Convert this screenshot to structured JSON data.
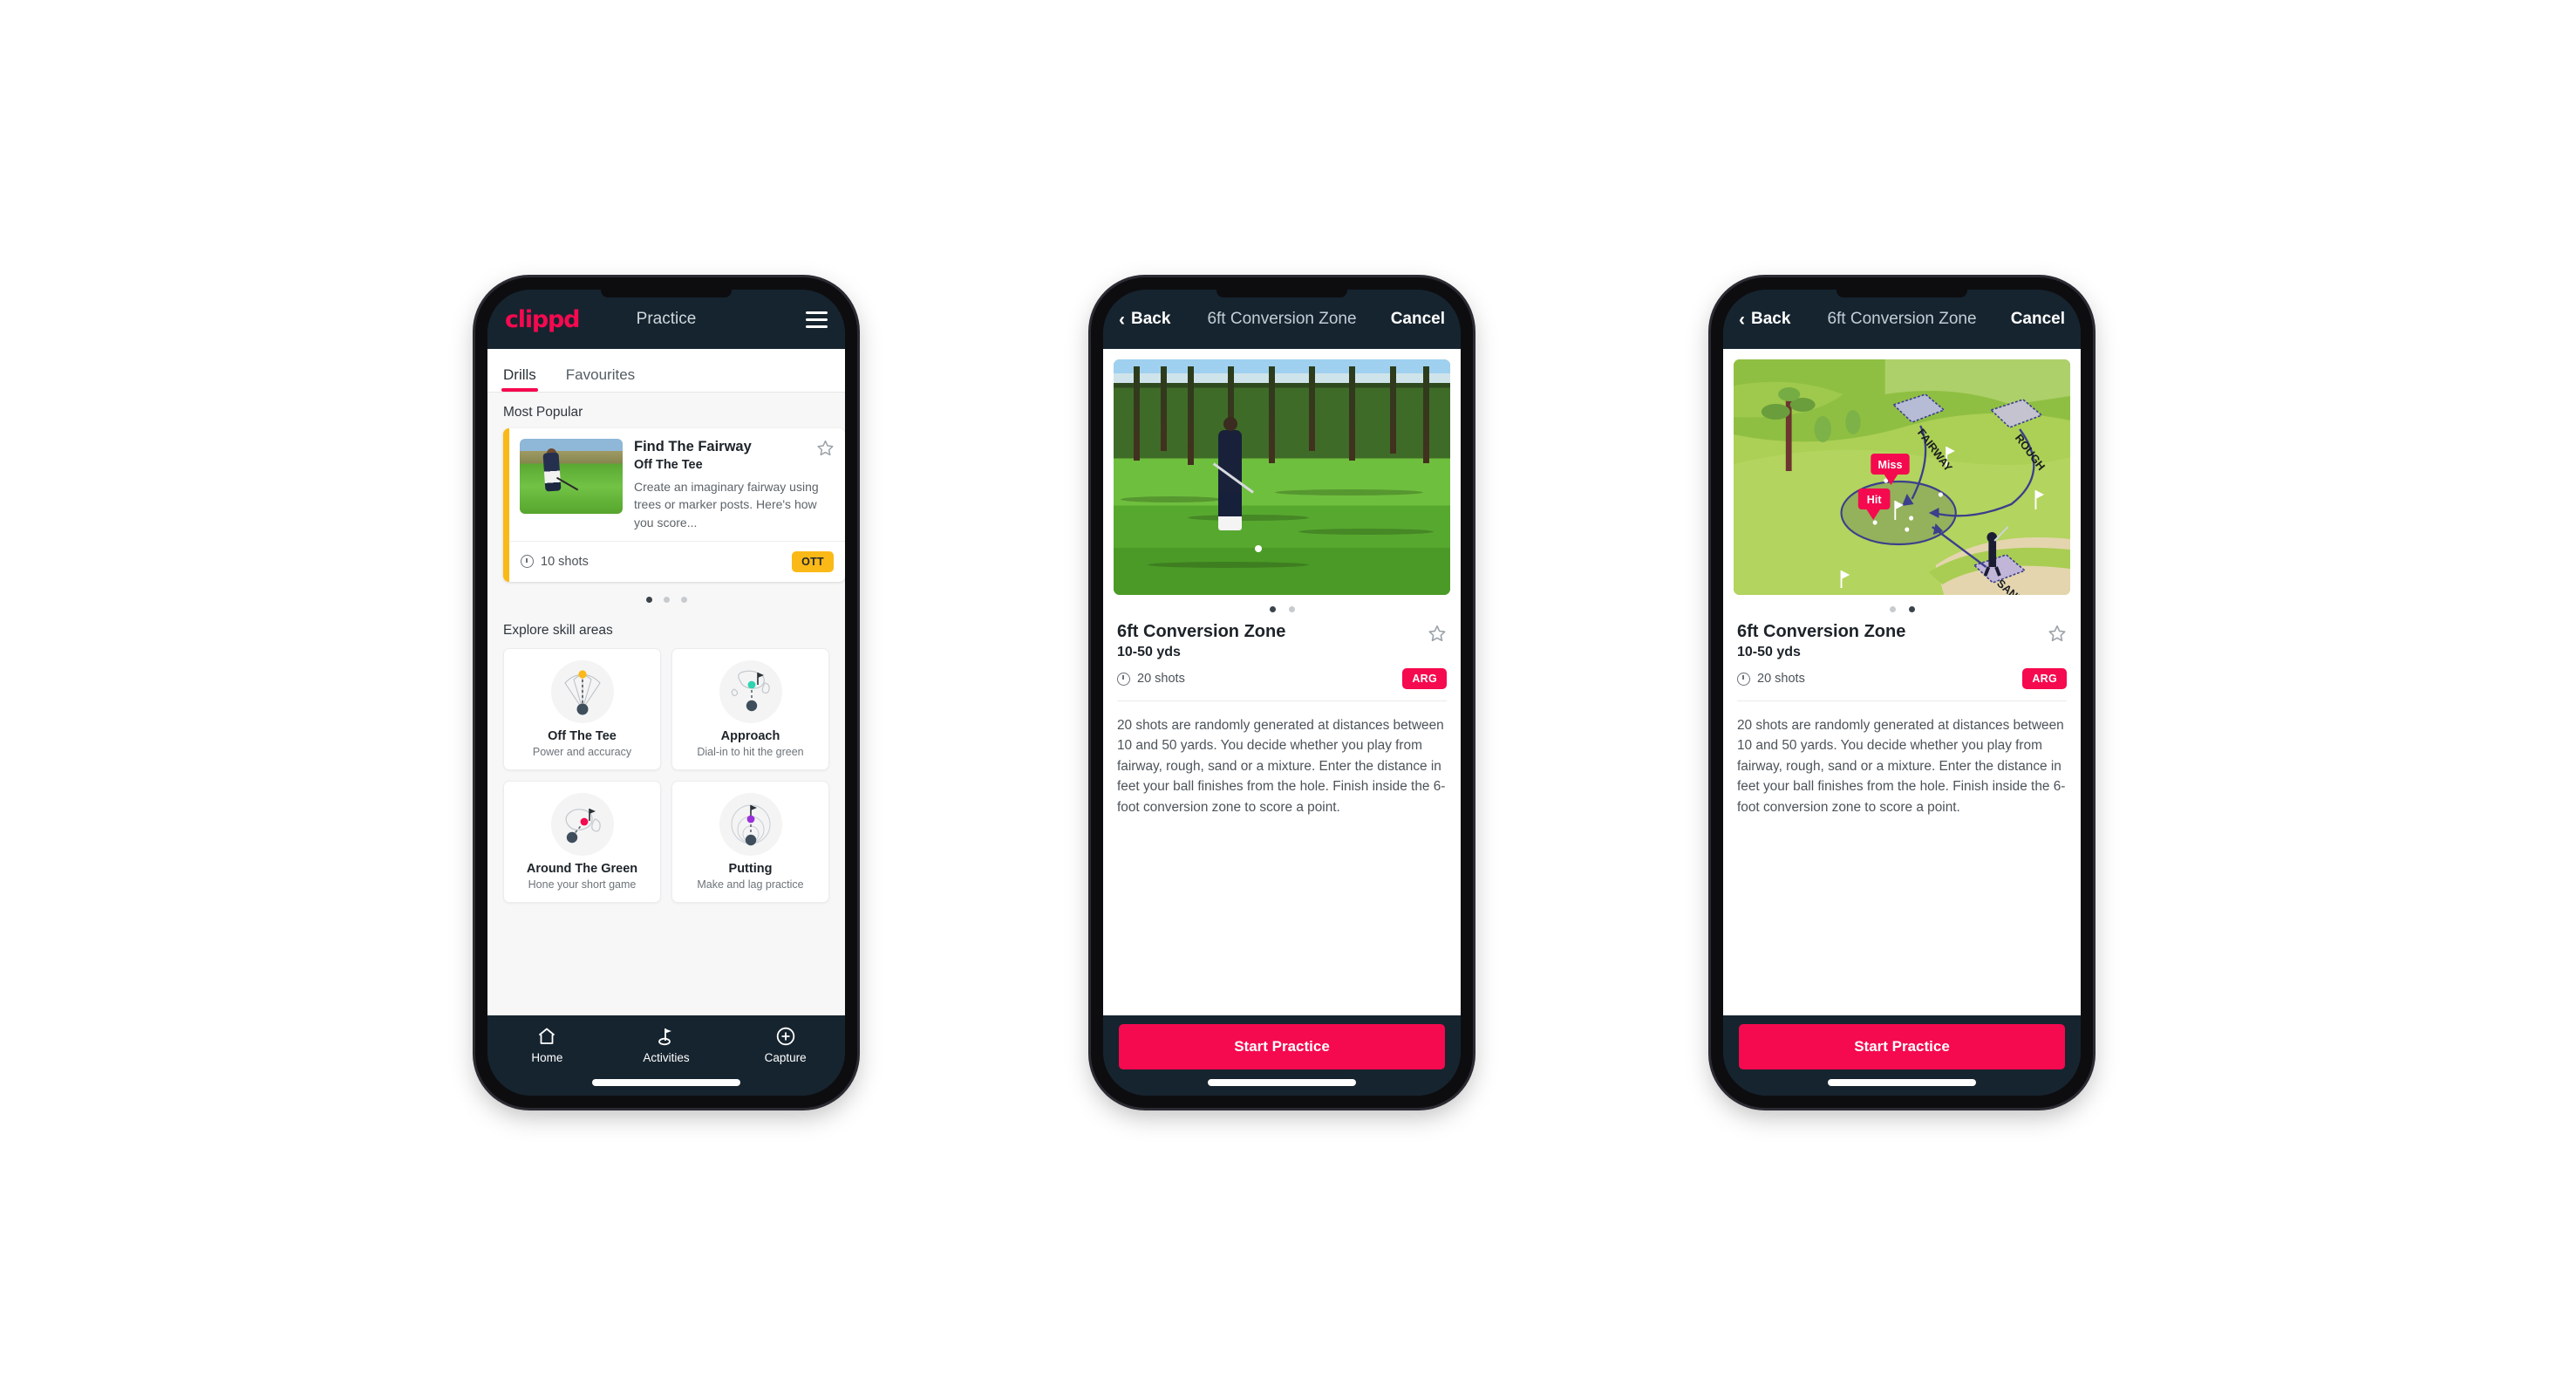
{
  "brand": "clippd",
  "phone1": {
    "appbar": {
      "title": "Practice",
      "menu_icon": "hamburger-icon"
    },
    "tabs": [
      {
        "label": "Drills",
        "active": true
      },
      {
        "label": "Favourites",
        "active": false
      }
    ],
    "sections": {
      "popular_label": "Most Popular",
      "explore_label": "Explore skill areas"
    },
    "popular_card": {
      "title": "Find The Fairway",
      "subtitle": "Off The Tee",
      "description": "Create an imaginary fairway using trees or marker posts. Here's how you score...",
      "shots": "10 shots",
      "badge": "OTT",
      "badge_color": "#fbb917",
      "star_icon": "star-outline-icon",
      "clock_icon": "clock-icon"
    },
    "carousel_dots": {
      "count": 3,
      "active_index": 0
    },
    "skills": [
      {
        "name": "Off The Tee",
        "desc": "Power and accuracy",
        "accent": "#fbb917",
        "icon": "tee-fan-icon"
      },
      {
        "name": "Approach",
        "desc": "Dial-in to hit the green",
        "accent": "#2ed3b0",
        "icon": "approach-green-icon"
      },
      {
        "name": "Around The Green",
        "desc": "Hone your short game",
        "accent": "#f5094f",
        "icon": "chip-green-icon"
      },
      {
        "name": "Putting",
        "desc": "Make and lag practice",
        "accent": "#9b30d9",
        "icon": "putting-rings-icon"
      }
    ],
    "bottom_nav": [
      {
        "label": "Home",
        "icon": "home-icon",
        "active": false
      },
      {
        "label": "Activities",
        "icon": "golf-flag-icon",
        "active": true
      },
      {
        "label": "Capture",
        "icon": "plus-circle-icon",
        "active": false
      }
    ]
  },
  "phone2": {
    "nav": {
      "back": "Back",
      "title": "6ft Conversion Zone",
      "cancel": "Cancel",
      "back_icon": "chevron-left-icon"
    },
    "media": {
      "type": "photo",
      "alt": "golfer-chipping-photo"
    },
    "dots": {
      "count": 2,
      "active_index": 0
    },
    "detail": {
      "title": "6ft Conversion Zone",
      "subtitle": "10-50 yds",
      "shots": "20 shots",
      "badge": "ARG",
      "badge_color": "#f5094f",
      "star_icon": "star-outline-icon",
      "clock_icon": "clock-icon",
      "description": "20 shots are randomly generated at distances between 10 and 50 yards. You decide whether you play from fairway, rough, sand or a mixture. Enter the distance in feet your ball finishes from the hole. Finish inside the 6-foot conversion zone to score a point."
    },
    "cta": "Start Practice"
  },
  "phone3": {
    "nav": {
      "back": "Back",
      "title": "6ft Conversion Zone",
      "cancel": "Cancel",
      "back_icon": "chevron-left-icon"
    },
    "media": {
      "type": "illustration",
      "alt": "golf-hole-diagram",
      "labels": {
        "fairway": "FAIRWAY",
        "rough": "ROUGH",
        "sand": "SAND",
        "miss": "Miss",
        "hit": "Hit"
      }
    },
    "dots": {
      "count": 2,
      "active_index": 1
    },
    "detail": {
      "title": "6ft Conversion Zone",
      "subtitle": "10-50 yds",
      "shots": "20 shots",
      "badge": "ARG",
      "badge_color": "#f5094f",
      "star_icon": "star-outline-icon",
      "clock_icon": "clock-icon",
      "description": "20 shots are randomly generated at distances between 10 and 50 yards. You decide whether you play from fairway, rough, sand or a mixture. Enter the distance in feet your ball finishes from the hole. Finish inside the 6-foot conversion zone to score a point."
    },
    "cta": "Start Practice"
  },
  "theme": {
    "header_navy": "#16242f",
    "accent_pink": "#f5094f",
    "badge_amber": "#fbb917",
    "teal": "#3fd9c0",
    "page_bg": "#f7f7f8"
  }
}
